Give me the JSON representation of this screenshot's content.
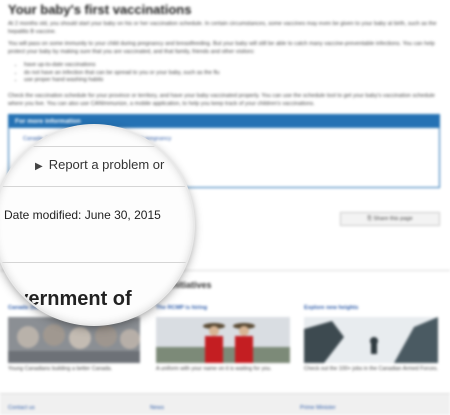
{
  "page": {
    "heading": "Your baby's first vaccinations",
    "paragraph1": "At 2 months old, you should start your baby on his or her vaccination schedule. In certain circumstances, some vaccines may even be given to your baby at birth, such as the hepatitis B vaccine.",
    "paragraph2": "You will pass on some immunity to your child during pregnancy and breastfeeding. But your baby will still be able to catch many vaccine-preventable infections. You can help protect your baby by making sure that you are vaccinated, and that family, friends and other visitors:",
    "bullets": [
      "have up-to-date vaccinations",
      "do not have an infection that can be spread to you or your baby, such as the flu",
      "use proper hand washing habits"
    ],
    "paragraph3": "Check the vaccination schedule for your province or territory, and have your baby vaccinated properly. You can use the schedule tool to get your baby's vaccination schedule where you live. You can also use CANImmunize, a mobile application, to help you keep track of your children's vaccinations."
  },
  "info_box": {
    "title": "For more information",
    "links": "Canada, Immunization: Health before and during pregnancy"
  },
  "share_label": "Share this page",
  "magnifier": {
    "report_label": "Report a problem or",
    "date_label": "Date modified:",
    "date_value": "June 30, 2015",
    "gov_text": "overnment of"
  },
  "initiatives": {
    "title": "initiatives",
    "items": [
      {
        "title": "Canada 150",
        "caption": "Young Canadians building a better Canada."
      },
      {
        "title": "The RCMP is hiring",
        "caption": "A uniform with your name on it is waiting for you."
      },
      {
        "title": "Explore new heights",
        "caption": "Check out the 100+ jobs in the Canadian Armed Forces."
      }
    ]
  },
  "footer": {
    "links": [
      "Contact us",
      "News",
      "Prime Minister"
    ]
  }
}
